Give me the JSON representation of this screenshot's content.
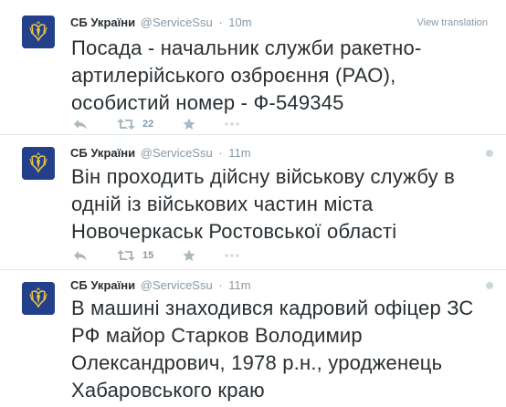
{
  "colors": {
    "accent": "#55acee",
    "name": "#292f33",
    "meta": "#8899a6",
    "divider": "#e1e8ed",
    "avatar_bg": "#24408a"
  },
  "tweets": [
    {
      "author": "СБ України",
      "handle": "@ServiceSsu",
      "separator": "·",
      "time": "10m",
      "view_translation": "View translation",
      "text": "Посада - начальник служби ракетно-артилерійського озброєння (РАО), особистий номер - Ф-549345",
      "retweet_count": "22",
      "icons": [
        "reply-icon",
        "retweet-icon",
        "favorite-icon",
        "more-icon"
      ]
    },
    {
      "author": "СБ України",
      "handle": "@ServiceSsu",
      "separator": "·",
      "time": "11m",
      "text": "Він проходить дійсну військову службу в одній із військових частин міста Новочеркаськ Ростовської області",
      "retweet_count": "15",
      "icons": [
        "reply-icon",
        "retweet-icon",
        "favorite-icon",
        "more-icon"
      ]
    },
    {
      "author": "СБ України",
      "handle": "@ServiceSsu",
      "separator": "·",
      "time": "11m",
      "text": "В машині знаходився кадровий офіцер ЗС РФ майор Старков Володимир Олександрович, 1978 р.н., уродженець Хабаровського краю"
    }
  ]
}
